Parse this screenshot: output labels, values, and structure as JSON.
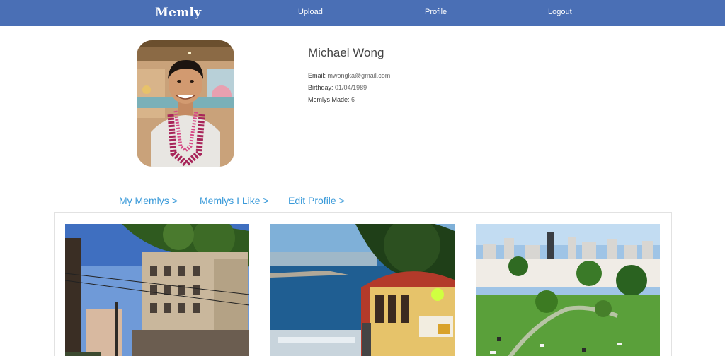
{
  "nav": {
    "brand": "Memly",
    "upload": "Upload",
    "profile": "Profile",
    "logout": "Logout",
    "bar_color": "#4a6fb5"
  },
  "profile": {
    "name": "Michael Wong",
    "email_label": "Email:",
    "email": "mwongka@gmail.com",
    "birthday_label": "Birthday:",
    "birthday": "01/04/1989",
    "memlys_label": "Memlys Made:",
    "memlys_count": "6"
  },
  "tabs": [
    {
      "label": "My Memlys >"
    },
    {
      "label": "Memlys I Like >"
    },
    {
      "label": "Edit Profile >"
    }
  ],
  "gallery": {
    "photos": [
      {
        "icon": "street-buildings-photo"
      },
      {
        "icon": "cable-car-photo"
      },
      {
        "icon": "park-skyline-photo"
      }
    ]
  },
  "colors": {
    "accent_link": "#3a9ad9",
    "navbar": "#4a6fb5"
  }
}
